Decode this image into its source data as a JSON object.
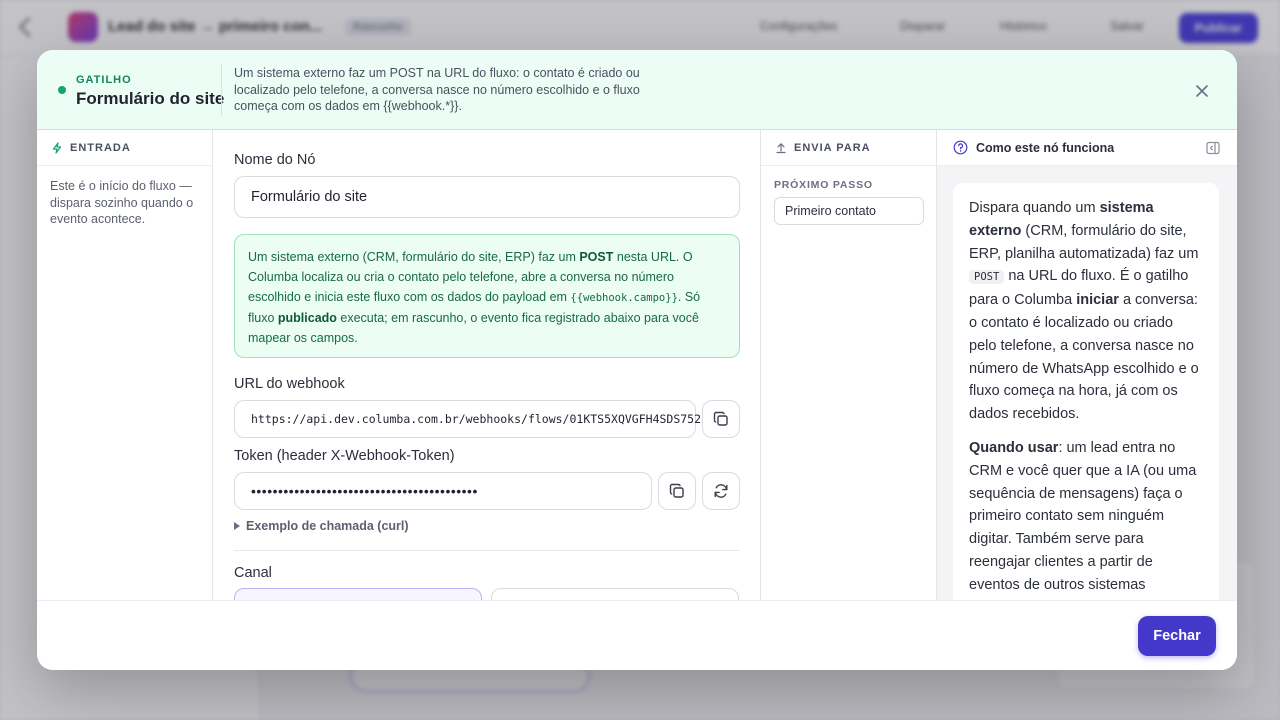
{
  "background": {
    "app_title": "Lead do site → primeiro con...",
    "badge": "Rascunho",
    "nav": [
      "Configurações",
      "Disparar",
      "Histórico",
      "Salvar"
    ],
    "save_label": "Publicar"
  },
  "header": {
    "kicker": "GATILHO",
    "title": "Formulário do site",
    "description": "Um sistema externo faz um POST na URL do fluxo: o contato é criado ou localizado pelo telefone, a conversa nasce no número escolhido e o fluxo começa com os dados em {{webhook.*}}."
  },
  "entrada": {
    "label": "ENTRADA",
    "text": "Este é o início do fluxo — dispara sozinho quando o evento acontece."
  },
  "form": {
    "node_name_label": "Nome do Nó",
    "node_name_value": "Formulário do site",
    "info": {
      "p1": "Um sistema externo (CRM, formulário do site, ERP) faz um ",
      "post": "POST",
      "p2": " nesta URL. O Columba localiza ou cria o contato pelo telefone, abre a conversa no número escolhido e inicia este fluxo com os dados do payload em ",
      "code": "{{webhook.campo}}",
      "p3": ". Só fluxo ",
      "publicado": "publicado",
      "p4": " executa; em rascunho, o evento fica registrado abaixo para você mapear os campos."
    },
    "webhook_label": "URL do webhook",
    "webhook_url": "https://api.dev.columba.com.br/webhooks/flows/01KTS5XQVGFH4SDS752",
    "token_label": "Token (header X-Webhook-Token)",
    "token_value": "••••••••••••••••••••••••••••••••••••••••••",
    "curl_label": "Exemplo de chamada (curl)",
    "canal_label": "Canal"
  },
  "envia": {
    "label": "ENVIA PARA",
    "next_label": "PRÓXIMO PASSO",
    "next_value": "Primeiro contato"
  },
  "help": {
    "title": "Como este nó funciona",
    "p1": {
      "a": "Dispara quando um ",
      "b": "sistema externo",
      "c": " (CRM, formulário do site, ERP, planilha automatizada) faz um ",
      "code": "POST",
      "d": " na URL do fluxo. É o gatilho para o Columba ",
      "e": "iniciar",
      "f": " a conversa: o contato é localizado ou criado pelo telefone, a conversa nasce no número de WhatsApp escolhido e o fluxo começa na hora, já com os dados recebidos."
    },
    "p2": {
      "a": "Quando usar",
      "b": ": um lead entra no CRM e você quer que a IA (ou uma sequência de mensagens) faça o primeiro contato sem ninguém digitar. Também serve para reengajar clientes a partir de eventos de outros sistemas"
    }
  },
  "footer": {
    "close_label": "Fechar"
  },
  "colors": {
    "accent": "#4338ca",
    "trigger_green": "#16a46a",
    "info_bg": "#ecfdf3"
  }
}
